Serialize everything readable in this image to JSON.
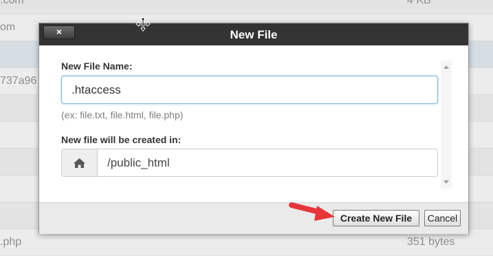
{
  "background_list": {
    "rows": [
      {
        "name": ".com",
        "size": "4 KB"
      },
      {
        "name": "om",
        "size": ""
      },
      {
        "name": "",
        "size": ""
      },
      {
        "name": "737a96",
        "size": ""
      },
      {
        "name": "",
        "size": ""
      },
      {
        "name": "",
        "size": ""
      },
      {
        "name": "",
        "size": ""
      },
      {
        "name": "",
        "size": ""
      },
      {
        "name": ".php",
        "size": "351 bytes"
      }
    ]
  },
  "dialog": {
    "title": "New File",
    "close_label": "×",
    "file_name_label": "New File Name:",
    "file_name_value": ".htaccess",
    "file_name_hint": "(ex: file.txt, file.html, file.php)",
    "location_label": "New file will be created in:",
    "location_icon": "home-icon",
    "location_value": "/public_html",
    "create_button": "Create New File",
    "cancel_button": "Cancel"
  },
  "colors": {
    "header": "#333333",
    "annotation_arrow": "#e8353a",
    "input_focus": "#7fb6d8"
  }
}
